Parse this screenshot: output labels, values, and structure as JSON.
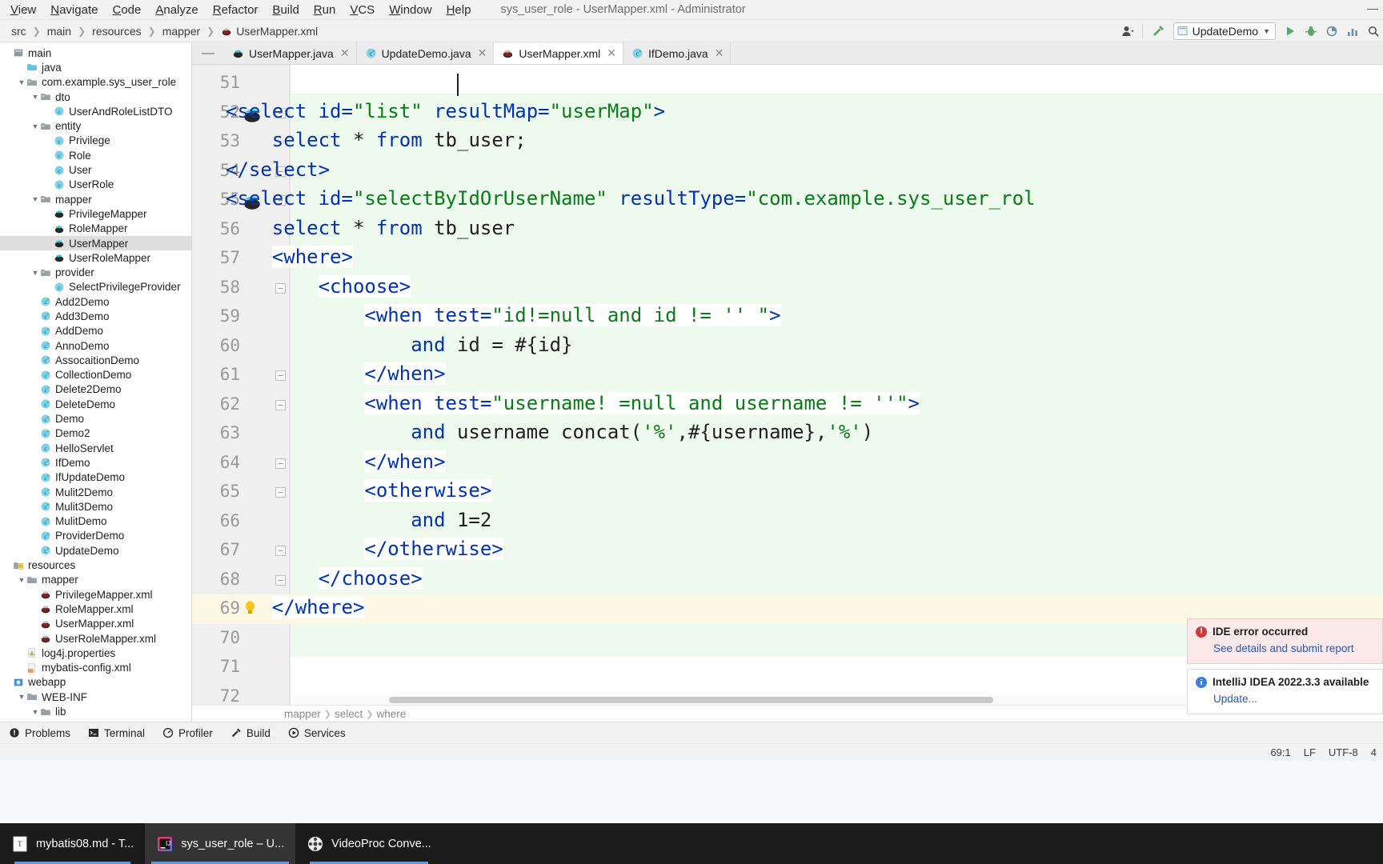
{
  "window": {
    "title": "sys_user_role - UserMapper.xml - Administrator"
  },
  "menubar": {
    "items": [
      "View",
      "Navigate",
      "Code",
      "Analyze",
      "Refactor",
      "Build",
      "Run",
      "VCS",
      "Window",
      "Help"
    ]
  },
  "navbar": {
    "breadcrumbs": [
      "src",
      "main",
      "resources",
      "mapper",
      "UserMapper.xml"
    ],
    "run_config": "UpdateDemo",
    "icons": [
      "user-avatar-icon",
      "hammer-build-icon",
      "run-icon",
      "debug-icon",
      "coverage-icon",
      "profile-icon",
      "search-icon"
    ]
  },
  "sidebar": {
    "items": [
      {
        "label": "main",
        "depth": 0,
        "icon": "module-icon",
        "arrow": "",
        "selected": false
      },
      {
        "label": "java",
        "depth": 1,
        "icon": "source-folder-icon",
        "arrow": "",
        "selected": false
      },
      {
        "label": "com.example.sys_user_role",
        "depth": 1,
        "icon": "package-icon",
        "arrow": "v",
        "selected": false
      },
      {
        "label": "dto",
        "depth": 2,
        "icon": "package-icon",
        "arrow": "v",
        "selected": false
      },
      {
        "label": "UserAndRoleListDTO",
        "depth": 3,
        "icon": "class-icon",
        "arrow": "",
        "selected": false
      },
      {
        "label": "entity",
        "depth": 2,
        "icon": "package-icon",
        "arrow": "v",
        "selected": false
      },
      {
        "label": "Privilege",
        "depth": 3,
        "icon": "class-icon",
        "arrow": "",
        "selected": false
      },
      {
        "label": "Role",
        "depth": 3,
        "icon": "class-icon",
        "arrow": "",
        "selected": false
      },
      {
        "label": "User",
        "depth": 3,
        "icon": "class-icon",
        "arrow": "",
        "selected": false
      },
      {
        "label": "UserRole",
        "depth": 3,
        "icon": "class-icon",
        "arrow": "",
        "selected": false
      },
      {
        "label": "mapper",
        "depth": 2,
        "icon": "package-icon",
        "arrow": "v",
        "selected": false
      },
      {
        "label": "PrivilegeMapper",
        "depth": 3,
        "icon": "mybatis-mapper-icon",
        "arrow": "",
        "selected": false
      },
      {
        "label": "RoleMapper",
        "depth": 3,
        "icon": "mybatis-mapper-icon",
        "arrow": "",
        "selected": false
      },
      {
        "label": "UserMapper",
        "depth": 3,
        "icon": "mybatis-mapper-icon",
        "arrow": "",
        "selected": true
      },
      {
        "label": "UserRoleMapper",
        "depth": 3,
        "icon": "mybatis-mapper-icon",
        "arrow": "",
        "selected": false
      },
      {
        "label": "provider",
        "depth": 2,
        "icon": "package-icon",
        "arrow": "v",
        "selected": false
      },
      {
        "label": "SelectPrivilegeProvider",
        "depth": 3,
        "icon": "class-icon",
        "arrow": "",
        "selected": false
      },
      {
        "label": "Add2Demo",
        "depth": 2,
        "icon": "runnable-class-icon",
        "arrow": "",
        "selected": false
      },
      {
        "label": "Add3Demo",
        "depth": 2,
        "icon": "runnable-class-icon",
        "arrow": "",
        "selected": false
      },
      {
        "label": "AddDemo",
        "depth": 2,
        "icon": "runnable-class-icon",
        "arrow": "",
        "selected": false
      },
      {
        "label": "AnnoDemo",
        "depth": 2,
        "icon": "runnable-class-icon",
        "arrow": "",
        "selected": false
      },
      {
        "label": "AssocaitionDemo",
        "depth": 2,
        "icon": "runnable-class-icon",
        "arrow": "",
        "selected": false
      },
      {
        "label": "CollectionDemo",
        "depth": 2,
        "icon": "runnable-class-icon",
        "arrow": "",
        "selected": false
      },
      {
        "label": "Delete2Demo",
        "depth": 2,
        "icon": "runnable-class-icon",
        "arrow": "",
        "selected": false
      },
      {
        "label": "DeleteDemo",
        "depth": 2,
        "icon": "runnable-class-icon",
        "arrow": "",
        "selected": false
      },
      {
        "label": "Demo",
        "depth": 2,
        "icon": "runnable-class-icon",
        "arrow": "",
        "selected": false
      },
      {
        "label": "Demo2",
        "depth": 2,
        "icon": "runnable-class-icon",
        "arrow": "",
        "selected": false
      },
      {
        "label": "HelloServlet",
        "depth": 2,
        "icon": "class-icon",
        "arrow": "",
        "selected": false
      },
      {
        "label": "IfDemo",
        "depth": 2,
        "icon": "runnable-class-icon",
        "arrow": "",
        "selected": false
      },
      {
        "label": "IfUpdateDemo",
        "depth": 2,
        "icon": "runnable-class-icon",
        "arrow": "",
        "selected": false
      },
      {
        "label": "Mulit2Demo",
        "depth": 2,
        "icon": "runnable-class-icon",
        "arrow": "",
        "selected": false
      },
      {
        "label": "Mulit3Demo",
        "depth": 2,
        "icon": "runnable-class-icon",
        "arrow": "",
        "selected": false
      },
      {
        "label": "MulitDemo",
        "depth": 2,
        "icon": "runnable-class-icon",
        "arrow": "",
        "selected": false
      },
      {
        "label": "ProviderDemo",
        "depth": 2,
        "icon": "runnable-class-icon",
        "arrow": "",
        "selected": false
      },
      {
        "label": "UpdateDemo",
        "depth": 2,
        "icon": "runnable-class-icon",
        "arrow": "",
        "selected": false
      },
      {
        "label": "resources",
        "depth": 0,
        "icon": "resources-folder-icon",
        "arrow": "",
        "selected": false
      },
      {
        "label": "mapper",
        "depth": 1,
        "icon": "folder-icon",
        "arrow": "v",
        "selected": false
      },
      {
        "label": "PrivilegeMapper.xml",
        "depth": 2,
        "icon": "mybatis-xml-icon",
        "arrow": "",
        "selected": false
      },
      {
        "label": "RoleMapper.xml",
        "depth": 2,
        "icon": "mybatis-xml-icon",
        "arrow": "",
        "selected": false
      },
      {
        "label": "UserMapper.xml",
        "depth": 2,
        "icon": "mybatis-xml-icon",
        "arrow": "",
        "selected": false
      },
      {
        "label": "UserRoleMapper.xml",
        "depth": 2,
        "icon": "mybatis-xml-icon",
        "arrow": "",
        "selected": false
      },
      {
        "label": "log4j.properties",
        "depth": 1,
        "icon": "properties-icon",
        "arrow": "",
        "selected": false
      },
      {
        "label": "mybatis-config.xml",
        "depth": 1,
        "icon": "xml-icon",
        "arrow": "",
        "selected": false
      },
      {
        "label": "webapp",
        "depth": 0,
        "icon": "webapp-icon",
        "arrow": "",
        "selected": false
      },
      {
        "label": "WEB-INF",
        "depth": 1,
        "icon": "folder-icon",
        "arrow": "v",
        "selected": false
      },
      {
        "label": "lib",
        "depth": 2,
        "icon": "folder-icon",
        "arrow": "v",
        "selected": false
      }
    ]
  },
  "tabs": [
    {
      "label": "UserMapper.java",
      "icon": "mybatis-mapper-icon",
      "active": false
    },
    {
      "label": "UpdateDemo.java",
      "icon": "runnable-class-icon",
      "active": false
    },
    {
      "label": "UserMapper.xml",
      "icon": "mybatis-xml-icon",
      "active": true
    },
    {
      "label": "IfDemo.java",
      "icon": "runnable-class-icon",
      "active": false
    }
  ],
  "editor": {
    "first_line": 51,
    "lines": [
      {
        "num": 51,
        "indent": 0,
        "tokens": [],
        "fold": "",
        "bean": false,
        "caret": true
      },
      {
        "num": 52,
        "indent": 0,
        "fold": "minus",
        "bean": true,
        "tokens": [
          {
            "t": "<select ",
            "c": "tg"
          },
          {
            "t": "id=",
            "c": "at"
          },
          {
            "t": "\"list\"",
            "c": "vl"
          },
          {
            "t": " resultMap=",
            "c": "at"
          },
          {
            "t": "\"userMap\"",
            "c": "vl"
          },
          {
            "t": ">",
            "c": "tg"
          }
        ]
      },
      {
        "num": 53,
        "indent": 1,
        "fold": "",
        "bean": false,
        "tokens": [
          {
            "t": "select ",
            "c": "kw"
          },
          {
            "t": "* ",
            "c": "pl"
          },
          {
            "t": "from ",
            "c": "kw"
          },
          {
            "t": "tb_user;",
            "c": "pl"
          }
        ]
      },
      {
        "num": 54,
        "indent": 0,
        "fold": "minus-end",
        "bean": false,
        "tokens": [
          {
            "t": "</select>",
            "c": "tg"
          }
        ]
      },
      {
        "num": 55,
        "indent": 0,
        "fold": "minus",
        "bean": true,
        "tokens": [
          {
            "t": "<select ",
            "c": "tg"
          },
          {
            "t": "id=",
            "c": "at"
          },
          {
            "t": "\"selectByIdOrUserName\"",
            "c": "vl"
          },
          {
            "t": " resultType=",
            "c": "at"
          },
          {
            "t": "\"com.example.sys_user_rol",
            "c": "vl"
          }
        ]
      },
      {
        "num": 56,
        "indent": 1,
        "fold": "",
        "bean": false,
        "tokens": [
          {
            "t": "select ",
            "c": "kw"
          },
          {
            "t": "* ",
            "c": "pl"
          },
          {
            "t": "from ",
            "c": "kw"
          },
          {
            "t": "tb_user",
            "c": "pl"
          }
        ]
      },
      {
        "num": 57,
        "indent": 1,
        "fold": "minus",
        "bean": false,
        "hl": true,
        "tokens": [
          {
            "t": "<where>",
            "c": "tg"
          }
        ]
      },
      {
        "num": 58,
        "indent": 2,
        "fold": "minus",
        "bean": false,
        "hl": true,
        "tokens": [
          {
            "t": "<choose>",
            "c": "tg"
          }
        ]
      },
      {
        "num": 59,
        "indent": 3,
        "fold": "",
        "bean": false,
        "hl": true,
        "tokens": [
          {
            "t": "<when ",
            "c": "tg"
          },
          {
            "t": "test=",
            "c": "at"
          },
          {
            "t": "\"id!=null and id != '' \"",
            "c": "vl"
          },
          {
            "t": ">",
            "c": "tg"
          }
        ]
      },
      {
        "num": 60,
        "indent": 4,
        "fold": "",
        "bean": false,
        "tokens": [
          {
            "t": "and ",
            "c": "kw"
          },
          {
            "t": "id = #{id}",
            "c": "pl"
          }
        ]
      },
      {
        "num": 61,
        "indent": 3,
        "fold": "minus-end",
        "bean": false,
        "hl": true,
        "tokens": [
          {
            "t": "</when>",
            "c": "tg"
          }
        ]
      },
      {
        "num": 62,
        "indent": 3,
        "fold": "minus",
        "bean": false,
        "hl": true,
        "tokens": [
          {
            "t": "<when ",
            "c": "tg"
          },
          {
            "t": "test=",
            "c": "at"
          },
          {
            "t": "\"username! =null and username != ''\"",
            "c": "vl"
          },
          {
            "t": ">",
            "c": "tg"
          }
        ]
      },
      {
        "num": 63,
        "indent": 4,
        "fold": "",
        "bean": false,
        "tokens": [
          {
            "t": "and ",
            "c": "kw"
          },
          {
            "t": "username concat(",
            "c": "pl"
          },
          {
            "t": "'%'",
            "c": "vl"
          },
          {
            "t": ",#{username},",
            "c": "pl"
          },
          {
            "t": "'%'",
            "c": "vl"
          },
          {
            "t": ")",
            "c": "pl"
          }
        ]
      },
      {
        "num": 64,
        "indent": 3,
        "fold": "minus-end",
        "bean": false,
        "hl": true,
        "tokens": [
          {
            "t": "</when>",
            "c": "tg"
          }
        ]
      },
      {
        "num": 65,
        "indent": 3,
        "fold": "minus",
        "bean": false,
        "hl": true,
        "tokens": [
          {
            "t": "<otherwise>",
            "c": "tg"
          }
        ]
      },
      {
        "num": 66,
        "indent": 4,
        "fold": "",
        "bean": false,
        "tokens": [
          {
            "t": "and ",
            "c": "kw"
          },
          {
            "t": "1=2",
            "c": "pl"
          }
        ]
      },
      {
        "num": 67,
        "indent": 3,
        "fold": "minus-end",
        "bean": false,
        "hl": true,
        "tokens": [
          {
            "t": "</otherwise>",
            "c": "tg"
          }
        ]
      },
      {
        "num": 68,
        "indent": 2,
        "fold": "minus-end",
        "bean": false,
        "hl": true,
        "tokens": [
          {
            "t": "</choose>",
            "c": "tg"
          }
        ]
      },
      {
        "num": 69,
        "indent": 1,
        "fold": "bulb",
        "bean": false,
        "hl": true,
        "current": true,
        "tokens": [
          {
            "t": "</where>",
            "c": "tg"
          }
        ]
      },
      {
        "num": 70,
        "indent": 0,
        "fold": "",
        "bean": false,
        "tokens": []
      },
      {
        "num": 71,
        "indent": 0,
        "fold": "",
        "bean": false,
        "tokens": []
      },
      {
        "num": 72,
        "indent": 0,
        "fold": "",
        "bean": false,
        "tokens": []
      }
    ],
    "code_breadcrumbs": [
      "mapper",
      "select",
      "where"
    ]
  },
  "notifications": [
    {
      "type": "error",
      "title": "IDE error occurred",
      "link": "See details and submit report",
      "icon": "error-circle-icon"
    },
    {
      "type": "info",
      "title": "IntelliJ IDEA 2022.3.3 available",
      "link": "Update...",
      "icon": "info-circle-icon"
    }
  ],
  "tool_windows": [
    {
      "label": "Problems",
      "icon": "problems-icon"
    },
    {
      "label": "Terminal",
      "icon": "terminal-icon"
    },
    {
      "label": "Profiler",
      "icon": "profiler-icon"
    },
    {
      "label": "Build",
      "icon": "build-hammer-icon"
    },
    {
      "label": "Services",
      "icon": "services-icon"
    }
  ],
  "statusbar": {
    "caret": "69:1",
    "line_sep": "LF",
    "encoding": "UTF-8",
    "indent": "4"
  },
  "taskbar": [
    {
      "label": "mybatis08.md - T...",
      "icon": "typora-icon",
      "state": "open"
    },
    {
      "label": "sys_user_role – U...",
      "icon": "intellij-icon",
      "state": "active"
    },
    {
      "label": "VideoProc Conve...",
      "icon": "videoproc-icon",
      "state": "open"
    }
  ]
}
